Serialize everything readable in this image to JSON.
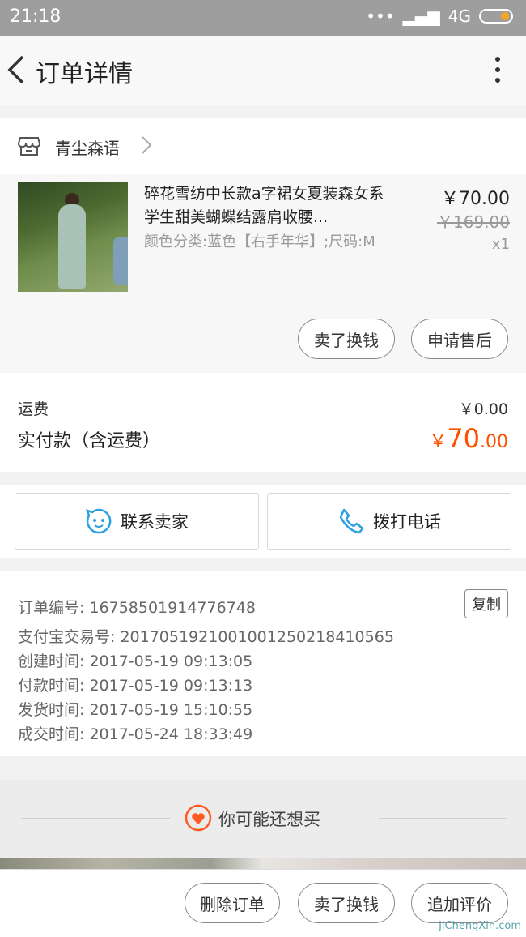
{
  "status_bar": {
    "time": "21:18",
    "signal": "•••",
    "network": "4G"
  },
  "nav": {
    "title": "订单详情"
  },
  "shop": {
    "name": "青尘森语"
  },
  "product": {
    "title": "碎花雪纺中长款a字裙女夏装森女系学生甜美蝴蝶结露肩收腰...",
    "spec": "颜色分类:蓝色【右手年华】;尺码:M",
    "price": "￥70.00",
    "original_price": "￥169.00",
    "quantity": "x1",
    "actions": {
      "sell": "卖了换钱",
      "after_sale": "申请售后"
    }
  },
  "fees": {
    "shipping_label": "运费",
    "shipping_value": "￥0.00",
    "paid_label": "实付款（含运费）",
    "paid_currency": "￥",
    "paid_int": "70",
    "paid_dec": ".00"
  },
  "contact": {
    "seller": "联系卖家",
    "call": "拨打电话"
  },
  "order_info": {
    "order_no": "订单编号: 1675850191477674​8",
    "copy": "复制",
    "alipay_no": "支付宝交易号: 2017051921001001250218410565",
    "created": "创建时间: 2017-05-19 09:13:05",
    "paid": "付款时间: 2017-05-19 09:13:13",
    "shipped": "发货时间: 2017-05-19 15:10:55",
    "completed": "成交时间: 2017-05-24 18:33:49"
  },
  "recommend": {
    "title": "你可能还想买"
  },
  "bottom_actions": {
    "delete": "删除订单",
    "sell": "卖了换钱",
    "review": "追加评价"
  },
  "watermark": "JiChengXin.com",
  "colors": {
    "accent": "#ff5000",
    "blue_icon": "#2da0e1",
    "status_bar": "#9e9e9e"
  }
}
